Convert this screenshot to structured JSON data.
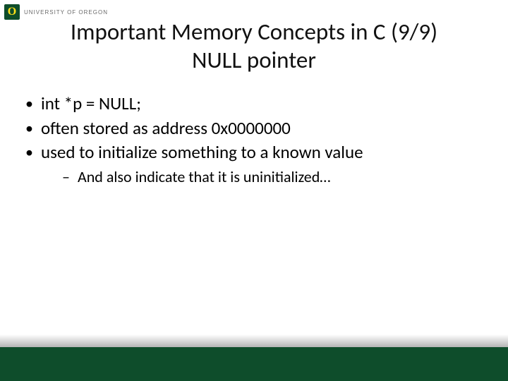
{
  "header": {
    "logo_letter": "O",
    "university": "UNIVERSITY OF OREGON"
  },
  "title": {
    "line1": "Important Memory Concepts in C (9/9)",
    "line2": "NULL pointer"
  },
  "bullets": {
    "b1": "int *p = NULL;",
    "b2": "often stored as address 0x0000000",
    "b3": "used to initialize something to a known value",
    "b3_sub1": "And also indicate that it is uninitialized…"
  }
}
